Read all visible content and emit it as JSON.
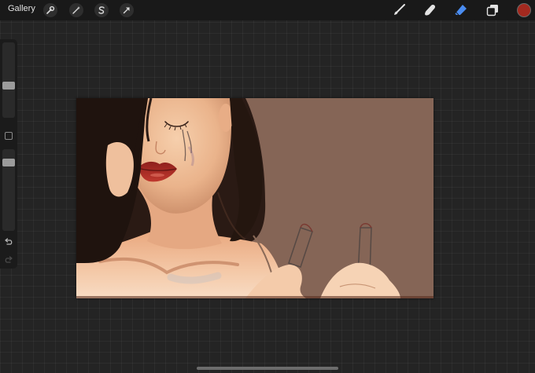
{
  "toolbar": {
    "gallery_label": "Gallery",
    "left_tools": [
      {
        "name": "actions",
        "icon": "wrench-icon"
      },
      {
        "name": "adjustments",
        "icon": "magic-wand-icon"
      },
      {
        "name": "selection",
        "icon": "selection-s-icon"
      },
      {
        "name": "transform",
        "icon": "arrow-cursor-icon"
      }
    ],
    "right_tools": [
      {
        "name": "brush",
        "icon": "brush-icon"
      },
      {
        "name": "smudge",
        "icon": "smudge-finger-icon"
      },
      {
        "name": "eraser",
        "icon": "eraser-icon",
        "active": true
      },
      {
        "name": "layers",
        "icon": "layers-icon"
      }
    ],
    "current_color": "#a3291f",
    "active_tool_color": "#4a8cf0"
  },
  "sidebar": {
    "brush_size_level": 0.58,
    "opacity_level": 0.13,
    "icons": [
      "modify-square-icon",
      "undo-icon",
      "redo-icon"
    ]
  },
  "canvas": {
    "background_color": "#856556"
  }
}
